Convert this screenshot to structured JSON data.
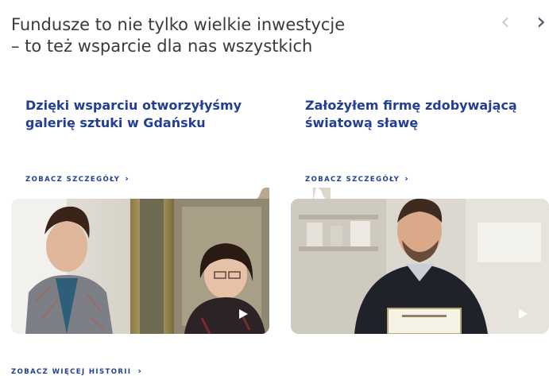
{
  "header": {
    "title_line1": "Fundusze to nie tylko wielkie inwestycje",
    "title_line2": "– to też wsparcie dla nas wszystkich"
  },
  "nav": {
    "prev_icon": "‹",
    "next_icon": "›"
  },
  "cards": [
    {
      "title_line1": "Dzięki wsparciu otworzyłyśmy",
      "title_line2": "galerię sztuki w Gdańsku",
      "link_label": "ZOBACZ SZCZEGÓŁY",
      "link_icon": "›"
    },
    {
      "title_line1": "Założyłem firmę zdobywającą",
      "title_line2": "światową sławę",
      "link_label": "ZOBACZ SZCZEGÓŁY",
      "link_icon": "›"
    }
  ],
  "footer": {
    "more_label": "ZOBACZ WIĘCEJ HISTORII",
    "more_icon": "›"
  },
  "colors": {
    "brand_blue": "#223e96",
    "title_text": "#3a3a3a",
    "nav_disabled": "#c8cdd6",
    "nav_active": "#4a5568"
  }
}
